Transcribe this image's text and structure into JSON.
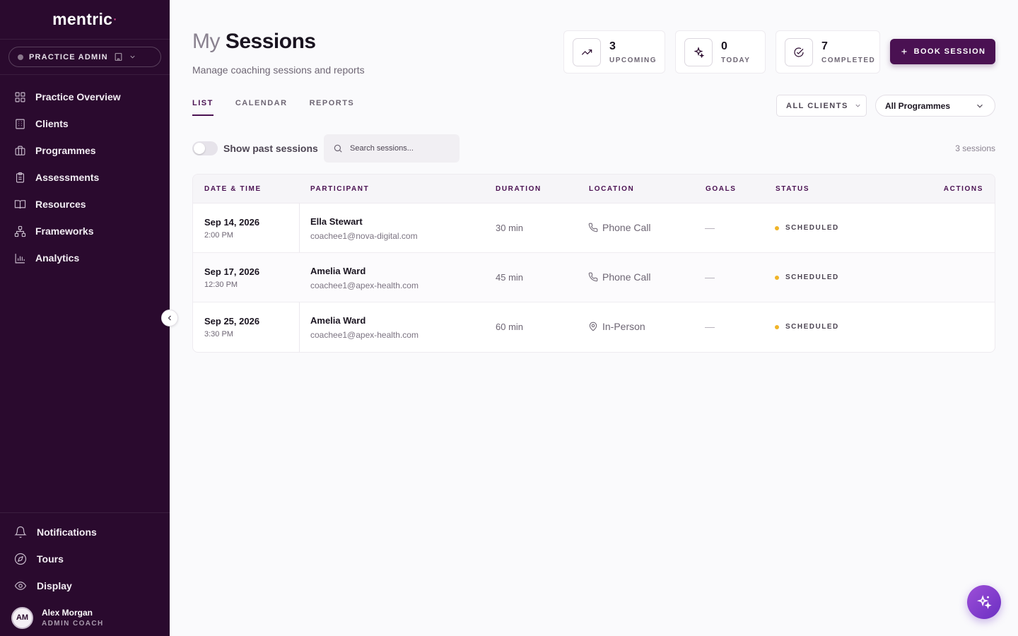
{
  "app": {
    "logo": "mentric",
    "role": "PRACTICE ADMIN"
  },
  "sidebar": {
    "items": [
      {
        "label": "Practice Overview",
        "icon": "grid-icon"
      },
      {
        "label": "Clients",
        "icon": "building-icon"
      },
      {
        "label": "Programmes",
        "icon": "briefcase-icon"
      },
      {
        "label": "Assessments",
        "icon": "clipboard-icon"
      },
      {
        "label": "Resources",
        "icon": "book-icon"
      },
      {
        "label": "Frameworks",
        "icon": "hierarchy-icon"
      },
      {
        "label": "Analytics",
        "icon": "bar-chart-icon"
      }
    ],
    "bottom": [
      {
        "label": "Notifications",
        "icon": "bell-icon"
      },
      {
        "label": "Tours",
        "icon": "compass-icon"
      },
      {
        "label": "Display",
        "icon": "eye-icon"
      }
    ],
    "user": {
      "initials": "AM",
      "name": "Alex Morgan",
      "role": "ADMIN COACH"
    }
  },
  "header": {
    "title_light": "My",
    "title_bold": "Sessions",
    "subtitle": "Manage coaching sessions and reports"
  },
  "stats": [
    {
      "value": "3",
      "label": "UPCOMING",
      "icon": "trend-up-icon"
    },
    {
      "value": "0",
      "label": "TODAY",
      "icon": "sparkle-icon"
    },
    {
      "value": "7",
      "label": "COMPLETED",
      "icon": "check-circle-icon"
    }
  ],
  "book_button": "BOOK SESSION",
  "tabs": [
    {
      "label": "LIST",
      "active": true
    },
    {
      "label": "CALENDAR",
      "active": false
    },
    {
      "label": "REPORTS",
      "active": false
    }
  ],
  "filters": {
    "clients": "ALL CLIENTS",
    "programmes": "All Programmes"
  },
  "toolbar": {
    "toggle_label": "Show past sessions",
    "search_placeholder": "Search sessions...",
    "count": "3 sessions"
  },
  "table": {
    "headers": [
      "DATE & TIME",
      "PARTICIPANT",
      "DURATION",
      "LOCATION",
      "GOALS",
      "STATUS",
      "ACTIONS"
    ],
    "rows": [
      {
        "date": "Sep 14, 2026",
        "time": "2:00 PM",
        "name": "Ella Stewart",
        "email": "coachee1@nova-digital.com",
        "duration": "30 min",
        "location": "Phone Call",
        "location_icon": "phone-icon",
        "goals": "—",
        "status": "SCHEDULED"
      },
      {
        "date": "Sep 17, 2026",
        "time": "12:30 PM",
        "name": "Amelia Ward",
        "email": "coachee1@apex-health.com",
        "duration": "45 min",
        "location": "Phone Call",
        "location_icon": "phone-icon",
        "goals": "—",
        "status": "SCHEDULED"
      },
      {
        "date": "Sep 25, 2026",
        "time": "3:30 PM",
        "name": "Amelia Ward",
        "email": "coachee1@apex-health.com",
        "duration": "60 min",
        "location": "In-Person",
        "location_icon": "map-pin-icon",
        "goals": "—",
        "status": "SCHEDULED"
      }
    ]
  },
  "colors": {
    "sidebar_bg": "#2a0a2e",
    "accent": "#4a1152",
    "status_scheduled": "#f0b429",
    "fab_gradient_start": "#9d4fd8",
    "fab_gradient_end": "#6b2fc2"
  }
}
